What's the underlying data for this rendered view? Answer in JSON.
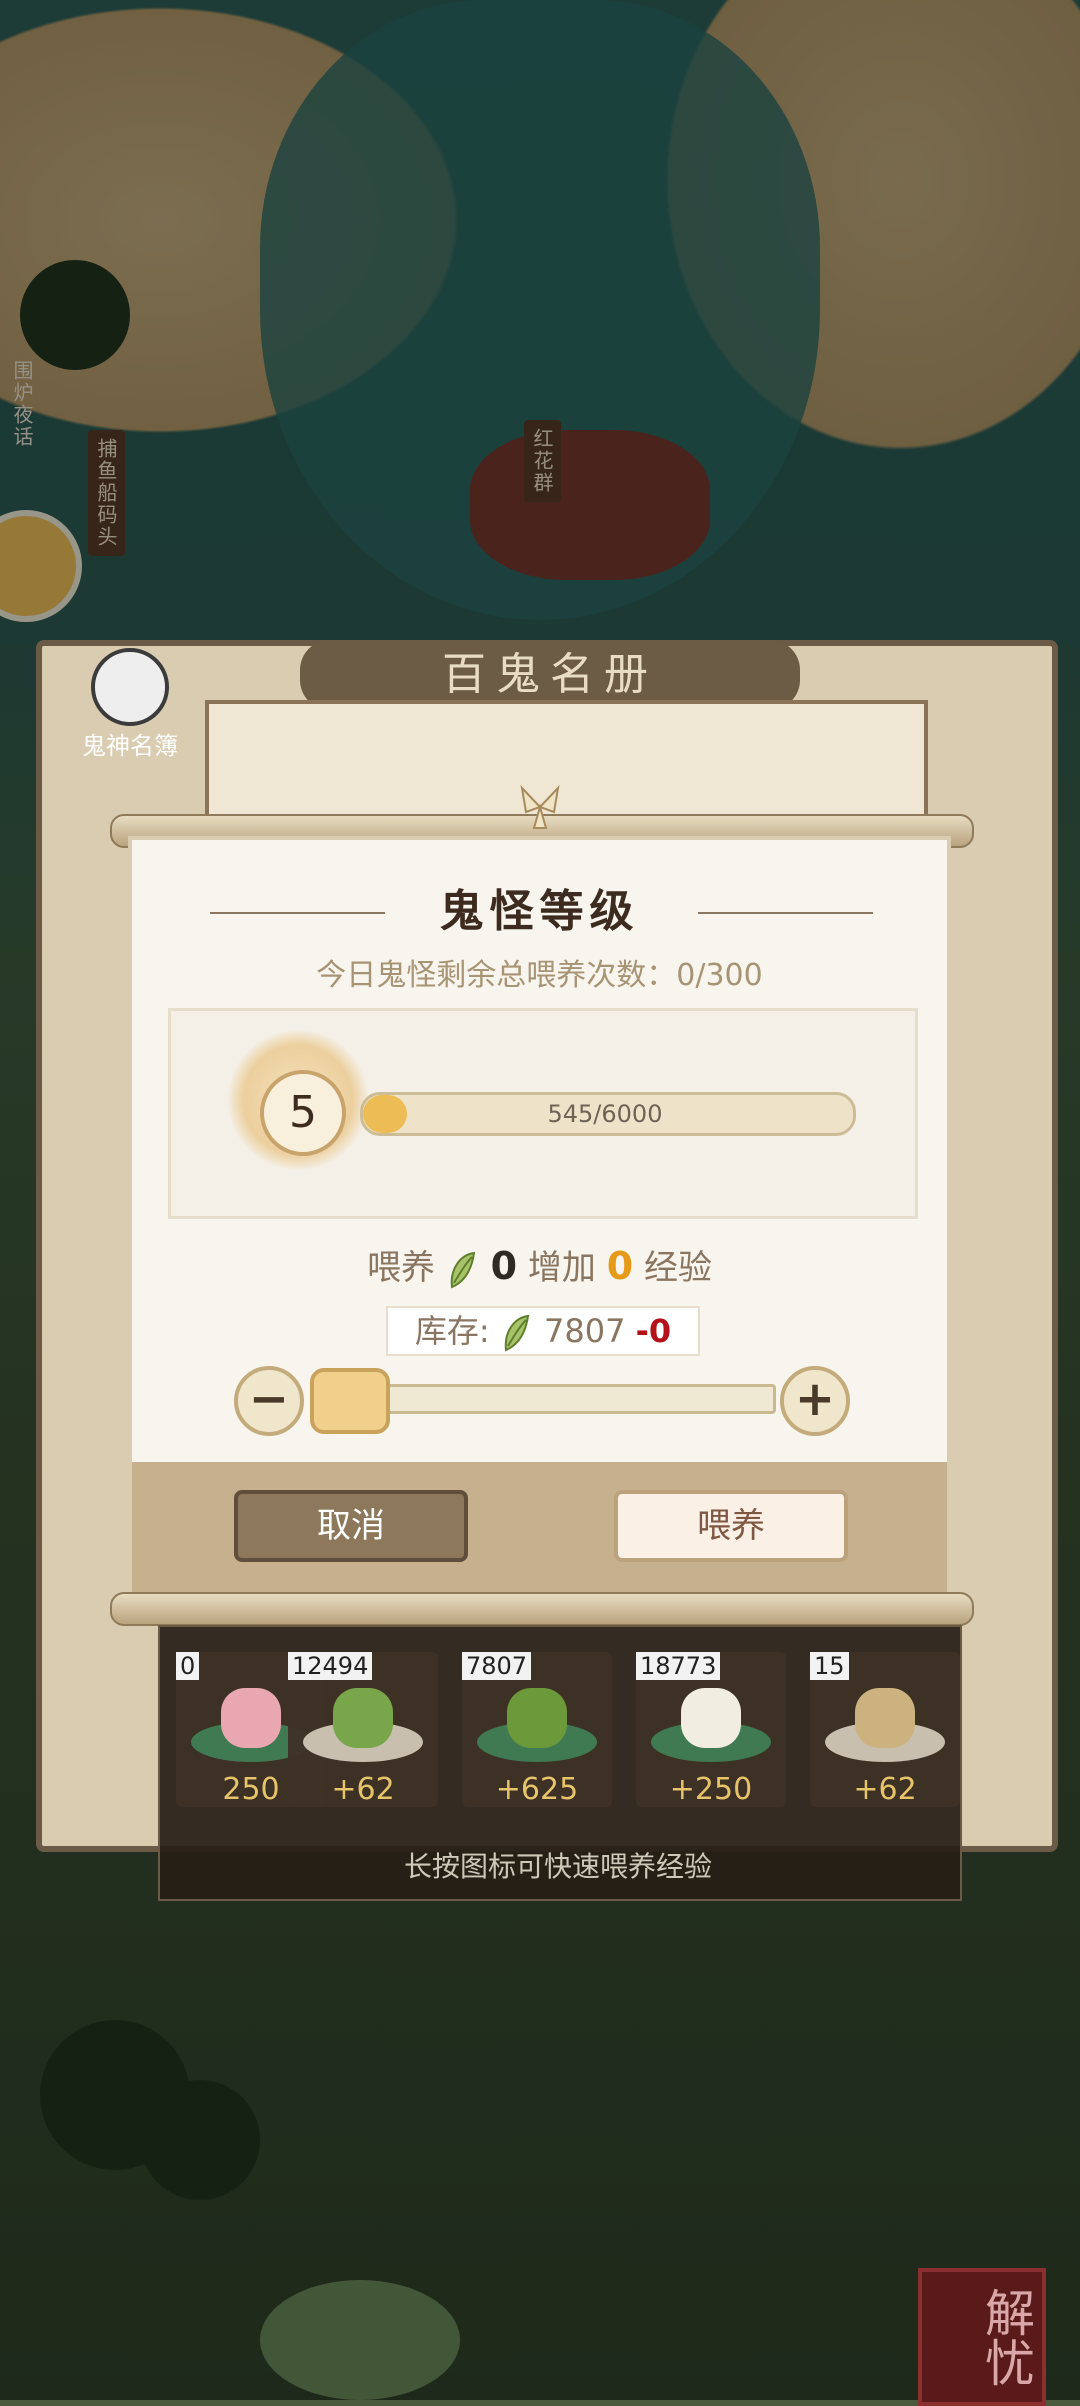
{
  "map": {
    "labels": [
      "围炉夜话",
      "捕鱼船码头",
      "红花群"
    ],
    "corner_badge": "解忧"
  },
  "back_panel": {
    "title": "百鬼名册",
    "tag": "鬼神名簿"
  },
  "modal": {
    "title": "鬼怪等级",
    "daily_label": "今日鬼怪剩余总喂养次数：",
    "daily_value": "0/300",
    "level": "5",
    "xp_text": "545/6000",
    "xp_progress": 0.0908,
    "feed_label": "喂养",
    "feed_amount": "0",
    "increase_label": "增加",
    "exp_gain": "0",
    "exp_label": "经验",
    "stock_label": "库存:",
    "stock_value": "7807",
    "stock_delta": "-0",
    "slider_value": 0,
    "minus_icon": "minus-icon",
    "plus_icon": "plus-icon",
    "cancel_label": "取消",
    "feed_button_label": "喂养"
  },
  "tray": {
    "items": [
      {
        "count": "0",
        "bonus": "250",
        "icon": "peach-blossom-icon",
        "color": "#e8a7b1"
      },
      {
        "count": "12494",
        "bonus": "+62",
        "icon": "herb-sprig-icon",
        "color": "#7aa64b"
      },
      {
        "count": "7807",
        "bonus": "+625",
        "icon": "bean-pod-icon",
        "color": "#6c9a3a"
      },
      {
        "count": "18773",
        "bonus": "+250",
        "icon": "white-flower-icon",
        "color": "#f1ede0"
      },
      {
        "count": "15",
        "bonus": "+62",
        "icon": "wood-log-icon",
        "color": "#cbb27f"
      }
    ],
    "hint": "长按图标可快速喂养经验"
  },
  "colors": {
    "accent_orange": "#e69a1a",
    "stock_red": "#b3121b",
    "xp_fill": "#edbc55"
  }
}
